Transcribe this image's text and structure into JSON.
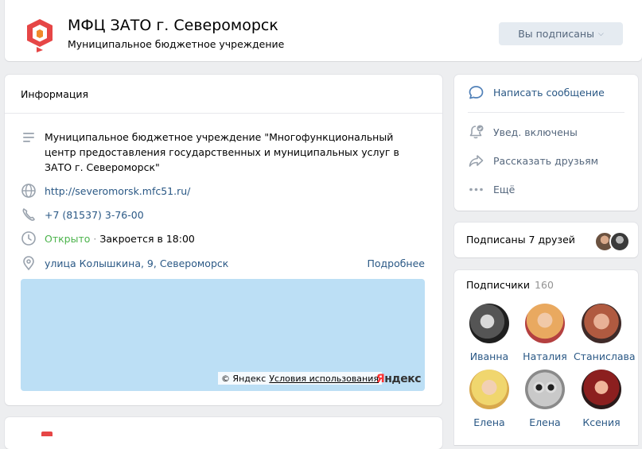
{
  "header": {
    "title": "МФЦ ЗАТО г. Североморск",
    "status": "Муниципальное бюджетное учреждение",
    "subscribe_label": "Вы подписаны",
    "logo_colors": [
      "#e64646",
      "#f08a2a",
      "#ffffff"
    ]
  },
  "info": {
    "title": "Информация",
    "description": "Муниципальное бюджетное учреждение \"Многофункциональный центр предоставления государственных и муниципальных услуг в ЗАТО г. Североморск\"",
    "website": "http://severomorsk.mfc51.ru/",
    "phone": "+7 (81537) 3-76-00",
    "hours_status": "Открыто",
    "hours_separator": "·",
    "hours_text": "Закроется в 18:00",
    "address": "улица Колышкина, 9, Североморск",
    "more_link": "Подробнее",
    "map": {
      "copyright": "© Яндекс",
      "terms": "Условия использования",
      "brand_first": "Я",
      "brand_rest": "ндекс"
    },
    "icons": [
      "list-icon",
      "globe-icon",
      "phone-icon",
      "clock-icon",
      "location-pin-icon"
    ]
  },
  "actions": {
    "message": "Написать сообщение",
    "notifications": "Увед. включены",
    "share": "Рассказать друзьям",
    "more": "Ещё"
  },
  "friends": {
    "label": "Подписаны 7 друзей"
  },
  "subscribers": {
    "title": "Подписчики",
    "count": "160",
    "items": [
      {
        "name": "Иванна"
      },
      {
        "name": "Наталия"
      },
      {
        "name": "Станислава"
      },
      {
        "name": "Елена"
      },
      {
        "name": "Елена"
      },
      {
        "name": "Ксения"
      }
    ]
  },
  "colors": {
    "background": "#edeef0",
    "link": "#2a5885",
    "open": "#4bb34b",
    "button_bg": "#e5ebf1",
    "map": "#bcdff5"
  }
}
